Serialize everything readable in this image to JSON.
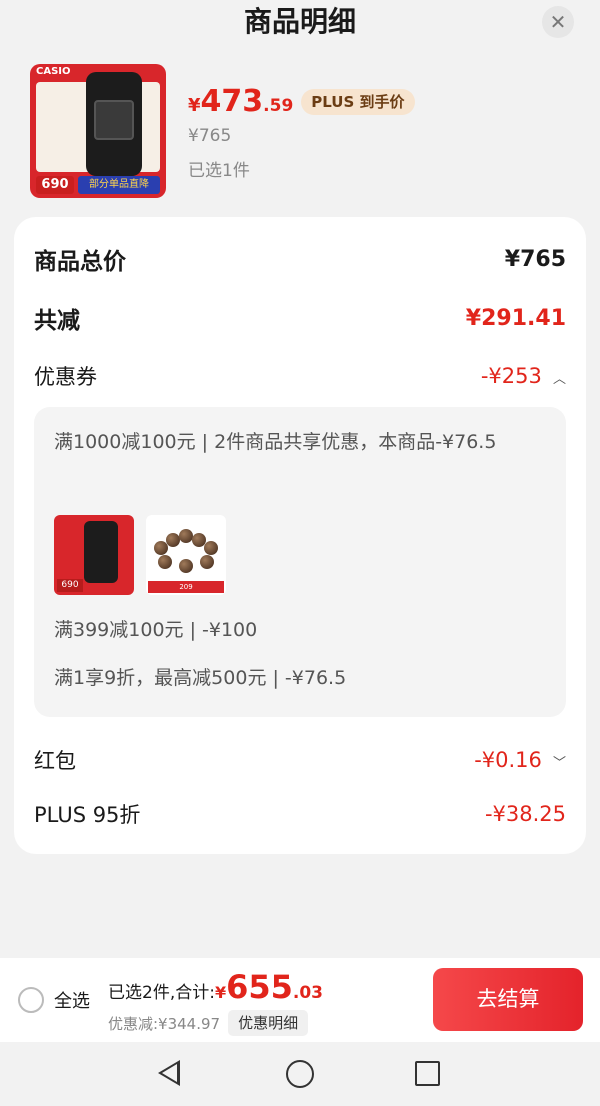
{
  "header": {
    "title": "商品明细",
    "close_label": "✕"
  },
  "product": {
    "price_symbol": "¥",
    "price_int": "473",
    "price_dec": ".59",
    "plus_badge": "PLUS 到手价",
    "original_price": "¥765",
    "selected_text": "已选1件",
    "thumb_brand": "CASIO",
    "thumb_price": "690",
    "thumb_strip": "部分单品直降"
  },
  "detail": {
    "total_label": "商品总价",
    "total_value": "¥765",
    "reduce_label": "共减",
    "reduce_value": "¥291.41",
    "coupon_label": "优惠券",
    "coupon_value": "-¥253",
    "coupon_lines": [
      "满1000减100元 | 2件商品共享优惠，本商品-¥76.5",
      "满399减100元 | -¥100",
      "满1享9折，最高减500元 | -¥76.5"
    ],
    "mini_watch_tag": "690",
    "mini_beads_tag": "209",
    "redpacket_label": "红包",
    "redpacket_value": "-¥0.16",
    "plus_label": "PLUS 95折",
    "plus_value": "-¥38.25"
  },
  "bottom": {
    "select_all": "全选",
    "summary_prefix": "已选2件,合计:",
    "total_symbol": "¥",
    "total_int": "655",
    "total_dec": ".03",
    "discount_text": "优惠减:¥344.97",
    "detail_button": "优惠明细",
    "checkout_button": "去结算"
  },
  "colors": {
    "accent_red": "#e1251b",
    "plus_badge_bg": "#f7e4cf",
    "checkout_bg": "#e4232b"
  }
}
